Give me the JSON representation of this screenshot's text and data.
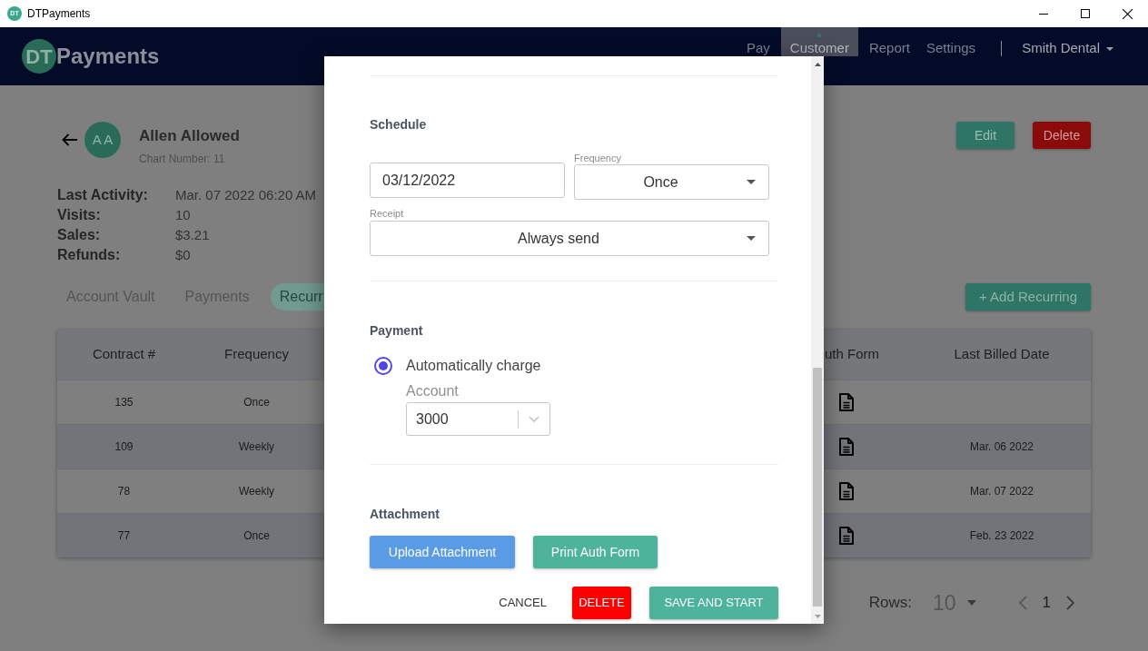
{
  "window": {
    "badge": "DT",
    "title": "DTPayments"
  },
  "header": {
    "logo_badge": "DT",
    "logo_text": "Payments",
    "nav": [
      {
        "label": "Pay",
        "selected": false
      },
      {
        "label": "Customer",
        "selected": true
      },
      {
        "label": "Report",
        "selected": false
      },
      {
        "label": "Settings",
        "selected": false
      }
    ],
    "account": "Smith Dental"
  },
  "customer": {
    "initials": "A A",
    "name": "Allen Allowed",
    "chart_number": "Chart Number: 11",
    "actions": [
      {
        "label": "Edit",
        "kind": "edit"
      },
      {
        "label": "Delete",
        "kind": "delete"
      }
    ],
    "stats": [
      {
        "label": "Last Activity:",
        "value": "Mar. 07 2022 06:20 AM"
      },
      {
        "label": "Visits:",
        "value": "10"
      },
      {
        "label": "Sales:",
        "value": "$3.21"
      },
      {
        "label": "Refunds:",
        "value": "$0"
      }
    ]
  },
  "tabs": [
    {
      "label": "Account Vault",
      "selected": false
    },
    {
      "label": "Payments",
      "selected": false
    },
    {
      "label": "Recurr",
      "selected": true
    }
  ],
  "add_button": "+ Add Recurring",
  "table": {
    "columns": [
      "Contract #",
      "Frequency",
      "uth Form",
      "Last Billed Date"
    ],
    "rows": [
      {
        "contract": "135",
        "frequency": "Once"
      },
      {
        "contract": "109",
        "frequency": "Weekly",
        "last_billed": "Mar. 06 2022"
      },
      {
        "contract": "78",
        "frequency": "Weekly",
        "last_billed": "Mar. 07 2022"
      },
      {
        "contract": "77",
        "frequency": "Once",
        "last_billed": "Feb. 23 2022"
      }
    ]
  },
  "pagination": {
    "label": "Rows:",
    "rows": "10",
    "page": "1"
  },
  "dialog": {
    "schedule": {
      "title": "Schedule",
      "date": "03/12/2022",
      "frequency": {
        "label": "Frequency",
        "value": "Once"
      },
      "receipt": {
        "label": "Receipt",
        "value": "Always send"
      }
    },
    "payment": {
      "title": "Payment",
      "options": [
        {
          "label": "Automatically charge",
          "selected": true
        }
      ],
      "account": {
        "label": "Account",
        "value": "3000"
      }
    },
    "attachment": {
      "title": "Attachment",
      "buttons": [
        {
          "label": "Upload Attachment",
          "kind": "upload"
        },
        {
          "label": "Print Auth Form",
          "kind": "print"
        }
      ]
    },
    "footer": [
      {
        "label": "CANCEL",
        "kind": "text"
      },
      {
        "label": "DELETE",
        "kind": "danger"
      },
      {
        "label": "SAVE AND START",
        "kind": "primary"
      }
    ]
  }
}
